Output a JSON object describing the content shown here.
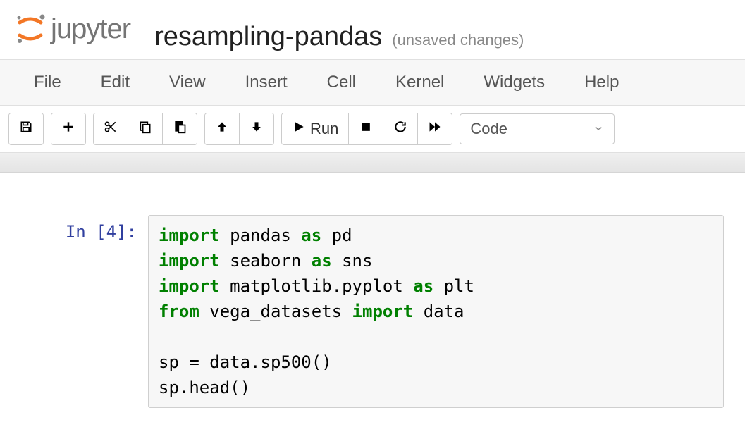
{
  "header": {
    "logo_text": "jupyter",
    "notebook_title": "resampling-pandas",
    "status": "(unsaved changes)"
  },
  "menubar": {
    "items": [
      "File",
      "Edit",
      "View",
      "Insert",
      "Cell",
      "Kernel",
      "Widgets",
      "Help"
    ]
  },
  "toolbar": {
    "save_icon": "save-icon",
    "add_icon": "plus-icon",
    "cut_icon": "scissors-icon",
    "copy_icon": "copy-icon",
    "paste_icon": "paste-icon",
    "up_icon": "arrow-up-icon",
    "down_icon": "arrow-down-icon",
    "run_label": "Run",
    "stop_icon": "stop-icon",
    "restart_icon": "restart-icon",
    "ff_icon": "fast-forward-icon",
    "cell_type_selected": "Code"
  },
  "cell": {
    "prompt": "In [4]:",
    "lines": [
      {
        "tokens": [
          [
            "kw",
            "import"
          ],
          [
            "nm",
            " pandas "
          ],
          [
            "kw",
            "as"
          ],
          [
            "nm",
            " pd"
          ]
        ]
      },
      {
        "tokens": [
          [
            "kw",
            "import"
          ],
          [
            "nm",
            " seaborn "
          ],
          [
            "kw",
            "as"
          ],
          [
            "nm",
            " sns"
          ]
        ]
      },
      {
        "tokens": [
          [
            "kw",
            "import"
          ],
          [
            "nm",
            " matplotlib.pyplot "
          ],
          [
            "kw",
            "as"
          ],
          [
            "nm",
            " plt"
          ]
        ]
      },
      {
        "tokens": [
          [
            "kw",
            "from"
          ],
          [
            "nm",
            " vega_datasets "
          ],
          [
            "kw",
            "import"
          ],
          [
            "nm",
            " data"
          ]
        ]
      },
      {
        "tokens": [
          [
            "nm",
            ""
          ]
        ]
      },
      {
        "tokens": [
          [
            "nm",
            "sp = data.sp500()"
          ]
        ]
      },
      {
        "tokens": [
          [
            "nm",
            "sp.head()"
          ]
        ]
      }
    ]
  }
}
